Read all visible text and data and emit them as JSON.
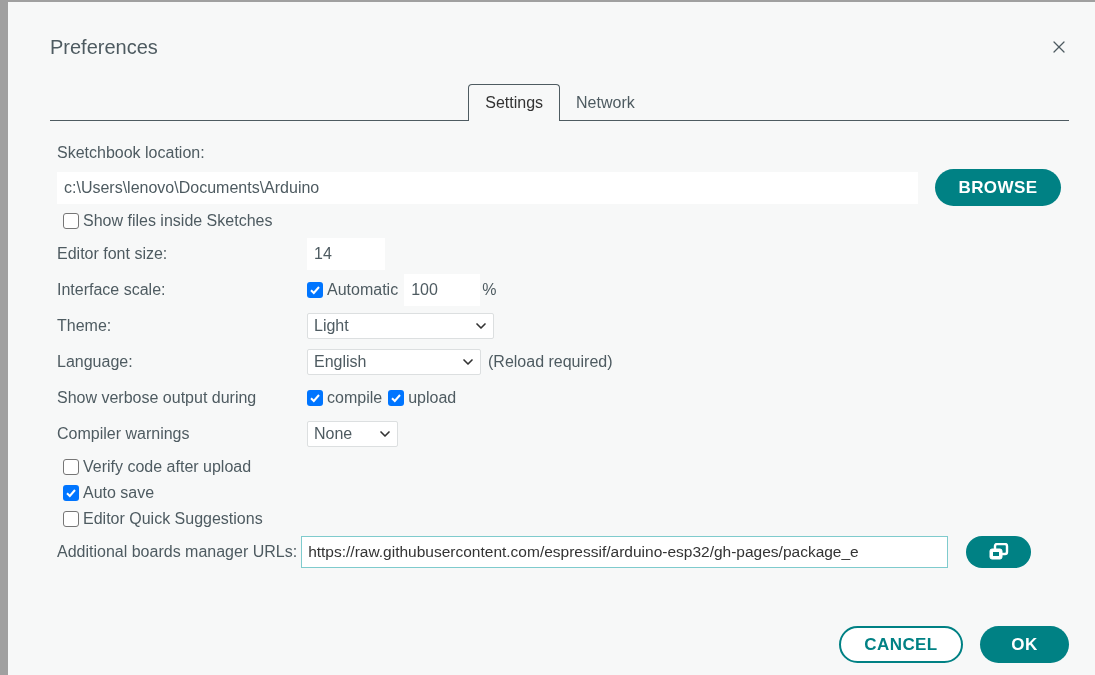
{
  "dialog": {
    "title": "Preferences"
  },
  "tabs": [
    {
      "label": "Settings",
      "selected": true
    },
    {
      "label": "Network",
      "selected": false
    }
  ],
  "sketchbook": {
    "label": "Sketchbook location:",
    "value": "c:\\Users\\lenovo\\Documents\\Arduino",
    "button": "BROWSE"
  },
  "show_files": {
    "label": "Show files inside Sketches",
    "checked": false
  },
  "font_size": {
    "label": "Editor font size:",
    "value": "14"
  },
  "interface_scale": {
    "label": "Interface scale:",
    "automatic": {
      "label": "Automatic",
      "checked": true
    },
    "value": "100",
    "unit": "%"
  },
  "theme": {
    "label": "Theme:",
    "value": "Light"
  },
  "language": {
    "label": "Language:",
    "value": "English",
    "note": "(Reload required)"
  },
  "verbose": {
    "label": "Show verbose output during",
    "options": [
      {
        "label": "compile",
        "checked": true
      },
      {
        "label": "upload",
        "checked": true
      }
    ]
  },
  "compiler_warnings": {
    "label": "Compiler warnings",
    "value": "None"
  },
  "options": [
    {
      "label": "Verify code after upload",
      "checked": false
    },
    {
      "label": "Auto save",
      "checked": true
    },
    {
      "label": "Editor Quick Suggestions",
      "checked": false
    }
  ],
  "board_urls": {
    "label": "Additional boards manager URLs:",
    "value": "https://raw.githubusercontent.com/espressif/arduino-esp32/gh-pages/package_e"
  },
  "buttons": [
    {
      "label": "CANCEL",
      "kind": "secondary"
    },
    {
      "label": "OK",
      "kind": "primary"
    }
  ]
}
